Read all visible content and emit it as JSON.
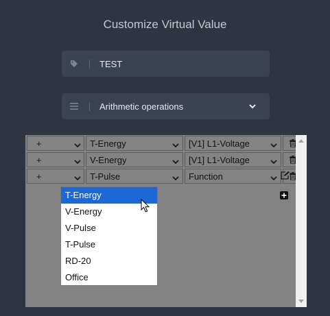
{
  "header": {
    "title": "Customize Virtual Value"
  },
  "name_field": {
    "icon": "tag-icon",
    "value": "TEST"
  },
  "type_field": {
    "icon": "list-icon",
    "value": "Arithmetic operations"
  },
  "rows": [
    {
      "operator": "+",
      "variable": "T-Energy",
      "parameter": "[V1] L1-Voltage"
    },
    {
      "operator": "+",
      "variable": "V-Energy",
      "parameter": "[V1] L1-Voltage"
    },
    {
      "operator": "+",
      "variable": "T-Pulse",
      "parameter": "Function"
    }
  ],
  "dropdown": {
    "options": [
      "T-Energy",
      "V-Energy",
      "V-Pulse",
      "T-Pulse",
      "RD-20",
      "Office"
    ],
    "selected_index": 0
  },
  "colors": {
    "background": "#2e3440",
    "field_bg": "#3b4252",
    "panel_bg": "#838383",
    "selection": "#1e68d6"
  }
}
